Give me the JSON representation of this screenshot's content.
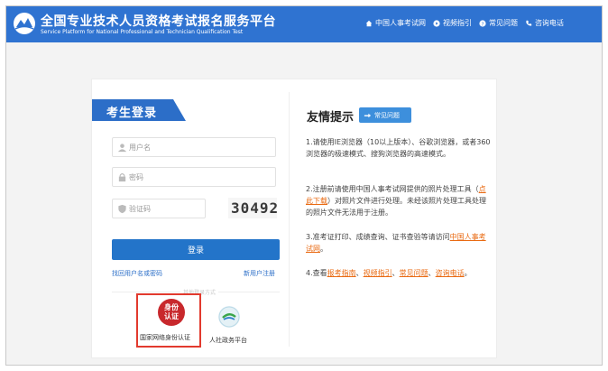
{
  "header": {
    "title": "全国专业技术人员资格考试报名服务平台",
    "subtitle": "Service Platform for National Professional and Technician Qualification Test",
    "nav": [
      {
        "icon": "home-icon",
        "label": "中国人事考试网"
      },
      {
        "icon": "play-icon",
        "label": "视频指引"
      },
      {
        "icon": "question-icon",
        "label": "常见问题"
      },
      {
        "icon": "phone-icon",
        "label": "咨询电话"
      }
    ]
  },
  "login": {
    "title": "考生登录",
    "username_placeholder": "用户名",
    "password_placeholder": "密码",
    "captcha_placeholder": "验证码",
    "captcha_text": "30492",
    "login_button": "登录",
    "forgot_link": "找回用户名或密码",
    "register_link": "新用户注册",
    "other_methods": "其他登录方式",
    "id_auth_icon_text": "身份认证",
    "id_auth_label": "国家网络身份认证",
    "gov_label": "人社政务平台"
  },
  "tips": {
    "title": "友情提示",
    "faq_button": "常见问题",
    "tip1": "1.请使用IE浏览器（10以上版本）、谷歌浏览器，或者360浏览器的极速模式、搜狗浏览器的高速模式。",
    "tip2_before": "2.注册前请使用中国人事考试网提供的照片处理工具（",
    "tip2_link": "点此下载",
    "tip2_after": "）对照片文件进行处理。未经该照片处理工具处理的照片文件无法用于注册。",
    "tip3_before": "3.准考证打印、成绩查询、证书查验等请访问",
    "tip3_link": "中国人事考试网",
    "tip3_after": "。",
    "tip4_prefix": "4.查看",
    "tip4_links": [
      "报考指南",
      "视频指引",
      "常见问题",
      "咨询电话"
    ],
    "tip4_suffix": "。"
  },
  "colors": {
    "header_blue": "#2f73d1",
    "button_blue": "#2374c9",
    "link_orange": "#e96a12",
    "highlight_red": "#e23a2e"
  }
}
